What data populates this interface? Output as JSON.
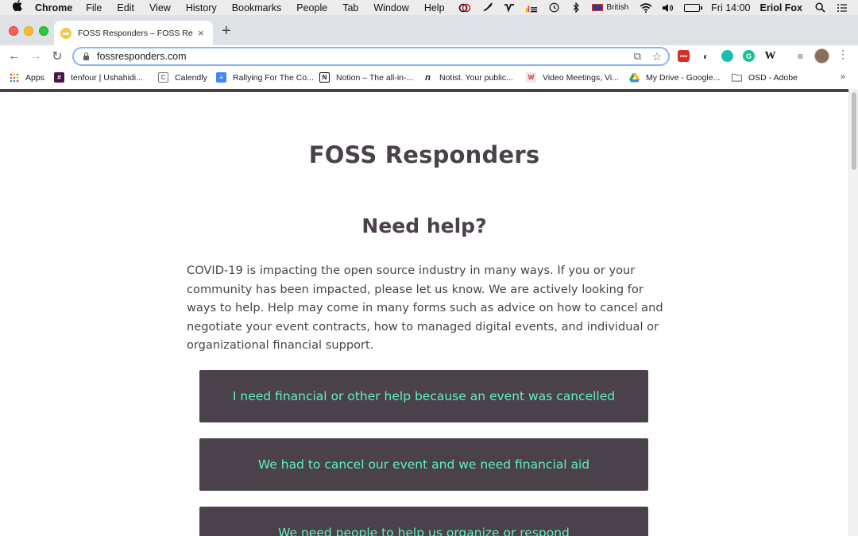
{
  "menubar": {
    "app_name": "Chrome",
    "items": [
      "File",
      "Edit",
      "View",
      "History",
      "Bookmarks",
      "People",
      "Tab",
      "Window",
      "Help"
    ],
    "input_language": "British",
    "clock": "Fri 14:00",
    "user": "Eriol Fox",
    "icons": [
      "apple-icon",
      "creative-cloud-icon",
      "rocket-icon",
      "vectorize-icon",
      "stats-icon",
      "time-machine-icon",
      "bluetooth-icon",
      "flag-icon",
      "wifi-icon",
      "volume-icon",
      "battery-icon",
      "search-icon",
      "control-center-icon"
    ]
  },
  "tab": {
    "title": "FOSS Responders – FOSS Respo",
    "close": "×",
    "new_tab": "+"
  },
  "toolbar": {
    "url": "fossresponders.com",
    "back": "←",
    "forward": "→",
    "reload": "↻",
    "cast": "⧉",
    "star": "☆",
    "extensions": [
      "lastpass-icon",
      "bird-icon",
      "teal-circle-icon",
      "grammarly-icon",
      "wikipedia-icon",
      "reading-list-icon"
    ],
    "ext_labels": [
      "•••",
      "◐",
      "",
      "G",
      "W",
      "≡"
    ],
    "menu": "⋮"
  },
  "bookmarks": {
    "items": [
      {
        "label": "Apps",
        "icon": "apps-grid-icon",
        "color": "#ea4335"
      },
      {
        "label": "tenfour | Ushahidi...",
        "icon": "slack-icon",
        "color": "#4a154b"
      },
      {
        "label": "Calendly",
        "icon": "calendly-icon",
        "color": "#ffffff"
      },
      {
        "label": "Rallying For The Co...",
        "icon": "google-docs-icon",
        "color": "#4285f4"
      },
      {
        "label": "Notion – The all-in-...",
        "icon": "notion-icon",
        "color": "#ffffff"
      },
      {
        "label": "Notist. Your public...",
        "icon": "notist-icon",
        "color": "#ffffff"
      },
      {
        "label": "Video Meetings, Vi...",
        "icon": "whereby-icon",
        "color": "#f5e3e3"
      },
      {
        "label": "My Drive - Google...",
        "icon": "google-drive-icon",
        "color": "#fbbc04"
      },
      {
        "label": "OSD - Adobe",
        "icon": "folder-icon",
        "color": "#ffffff"
      }
    ],
    "more": "»"
  },
  "page": {
    "site_title": "FOSS Responders",
    "help_heading": "Need help?",
    "intro": "COVID-19 is impacting the open source industry in many ways. If you or your community has been impacted, please let us know. We are actively looking for ways to help. Help may come in many forms such as advice on how to cancel and negotiate your event contracts, how to managed digital events, and individual or organizational financial support.",
    "cta_1": "I need financial or other help because an event was cancelled",
    "cta_2": "We had to cancel our event and we need financial aid",
    "cta_3": "We need people to help us organize or respond"
  },
  "colors": {
    "brand_dark": "#4a414b",
    "brand_accent": "#5ef2c0"
  }
}
